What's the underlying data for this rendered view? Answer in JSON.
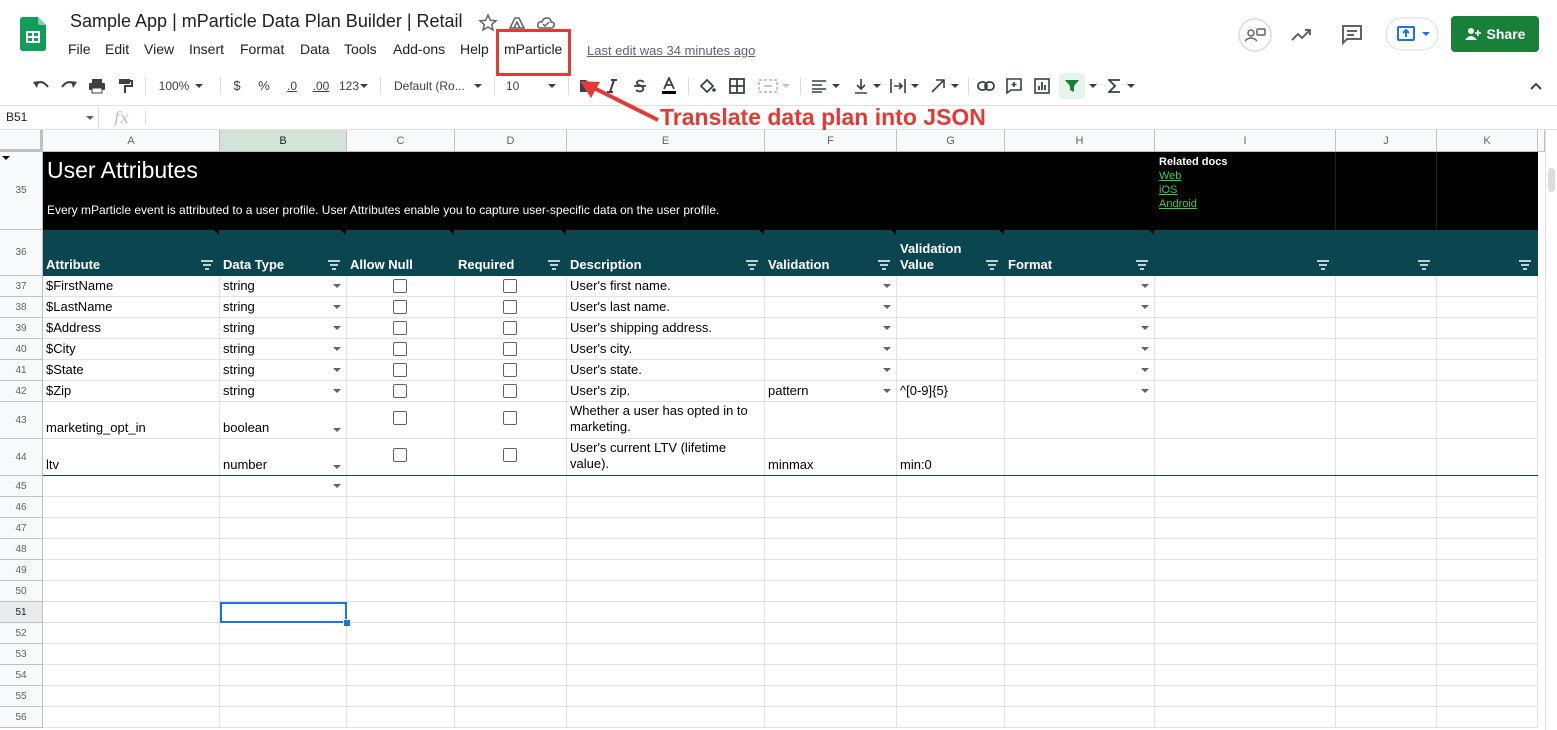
{
  "header": {
    "title": "Sample App | mParticle Data Plan Builder | Retail",
    "last_edit": "Last edit was 34 minutes ago",
    "share_label": "Share",
    "menu": [
      "File",
      "Edit",
      "View",
      "Insert",
      "Format",
      "Data",
      "Tools",
      "Add-ons",
      "Help",
      "mParticle"
    ]
  },
  "toolbar": {
    "zoom": "100%",
    "currency": "$",
    "percent": "%",
    "decimal_decrease": ".0",
    "decimal_increase": ".00",
    "number_format": "123",
    "font": "Default (Ro...",
    "font_size": "10"
  },
  "formula_bar": {
    "cell_ref": "B51",
    "fx": "fx"
  },
  "columns": [
    "A",
    "B",
    "C",
    "D",
    "E",
    "F",
    "G",
    "H",
    "I",
    "J",
    "K"
  ],
  "section": {
    "title": "User Attributes",
    "subtitle": "Every mParticle event is attributed to a user profile. User Attributes enable you to capture user-specific data on the user profile.",
    "related_title": "Related docs",
    "related_links": [
      "Web",
      "iOS",
      "Android"
    ]
  },
  "table": {
    "headers": [
      "Attribute",
      "Data Type",
      "Allow Null",
      "Required",
      "Description",
      "Validation",
      "Validation\nValue",
      "Format"
    ],
    "rows": [
      {
        "num": "37",
        "attr": "$FirstName",
        "type": "string",
        "desc": "User's first name.",
        "validation": "",
        "value": ""
      },
      {
        "num": "38",
        "attr": "$LastName",
        "type": "string",
        "desc": "User's last name.",
        "validation": "",
        "value": ""
      },
      {
        "num": "39",
        "attr": "$Address",
        "type": "string",
        "desc": "User's shipping address.",
        "validation": "",
        "value": ""
      },
      {
        "num": "40",
        "attr": "$City",
        "type": "string",
        "desc": "User's city.",
        "validation": "",
        "value": ""
      },
      {
        "num": "41",
        "attr": "$State",
        "type": "string",
        "desc": "User's state.",
        "validation": "",
        "value": ""
      },
      {
        "num": "42",
        "attr": "$Zip",
        "type": "string",
        "desc": "User's zip.",
        "validation": "pattern",
        "value": "^[0-9]{5}"
      },
      {
        "num": "43",
        "attr": "marketing_opt_in",
        "type": "boolean",
        "desc": "Whether a user has opted in to marketing.",
        "validation": "",
        "value": ""
      },
      {
        "num": "44",
        "attr": "ltv",
        "type": "number",
        "desc": "User's current LTV (lifetime value).",
        "validation": "minmax",
        "value": "min:0"
      }
    ],
    "section_row_num": "35",
    "header_row_num": "36",
    "empty_rows": [
      "45",
      "46",
      "47",
      "48",
      "49",
      "50",
      "51",
      "52",
      "53",
      "54",
      "55",
      "56"
    ]
  },
  "annotation": {
    "text": "Translate data plan into JSON"
  },
  "colors": {
    "header_teal": "#0b4650",
    "sheets_green": "#188038",
    "annotation_red": "#e53935",
    "link_green": "#34d058"
  }
}
